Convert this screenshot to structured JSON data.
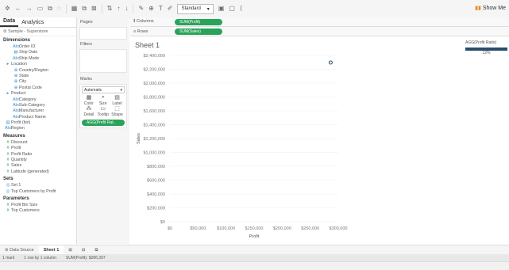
{
  "toolbar": {
    "icons": [
      "tableau-logo-icon",
      "undo-icon",
      "redo-icon",
      "save-icon",
      "new-datasource-icon",
      "pause-icon",
      "swap-icon",
      "sort-asc-icon",
      "sort-desc-icon",
      "highlight-icon",
      "group-icon",
      "label-icon",
      "format-icon",
      "fit-icon",
      "present-icon",
      "share-icon"
    ],
    "fit_select": "Standard",
    "show_me": "Show Me"
  },
  "left_panel": {
    "tabs": [
      "Data",
      "Analytics"
    ],
    "datasource": "Sample - Superstore",
    "dimensions_header": "Dimensions",
    "dimensions": [
      {
        "label": "Order ID",
        "level": 2,
        "icon": "Abc"
      },
      {
        "label": "Ship Date",
        "level": 2,
        "icon": "cal"
      },
      {
        "label": "Ship Mode",
        "level": 2,
        "icon": "Abc"
      },
      {
        "label": "Location",
        "level": 1,
        "icon": "hier"
      },
      {
        "label": "Country/Region",
        "level": 2,
        "icon": "geo"
      },
      {
        "label": "State",
        "level": 2,
        "icon": "geo"
      },
      {
        "label": "City",
        "level": 2,
        "icon": "geo"
      },
      {
        "label": "Postal Code",
        "level": 2,
        "icon": "geo"
      },
      {
        "label": "Product",
        "level": 1,
        "icon": "hier"
      },
      {
        "label": "Category",
        "level": 2,
        "icon": "Abc"
      },
      {
        "label": "Sub-Category",
        "level": 2,
        "icon": "Abc"
      },
      {
        "label": "Manufacturer",
        "level": 2,
        "icon": "Abc"
      },
      {
        "label": "Product Name",
        "level": 2,
        "icon": "Abc"
      },
      {
        "label": "Profit (bin)",
        "level": 1,
        "icon": "bin"
      },
      {
        "label": "Region",
        "level": 1,
        "icon": "Abc"
      }
    ],
    "measures_header": "Measures",
    "measures": [
      {
        "label": "Discount"
      },
      {
        "label": "Profit"
      },
      {
        "label": "Profit Ratio"
      },
      {
        "label": "Quantity"
      },
      {
        "label": "Sales"
      },
      {
        "label": "Latitude (generated)"
      }
    ],
    "sets_header": "Sets",
    "sets": [
      "Set 1",
      "Top Customers by Profit"
    ],
    "parameters_header": "Parameters",
    "parameters": [
      "Profit Bin Size",
      "Top Customers"
    ]
  },
  "pages_label": "Pages",
  "filters_label": "Filters",
  "marks": {
    "label": "Marks",
    "type": "Automatic",
    "buttons": [
      "Color",
      "Size",
      "Label",
      "Detail",
      "Tooltip",
      "Shape"
    ],
    "pill": "AGG(Profit Rat.."
  },
  "shelves": {
    "columns_label": "Columns",
    "columns_pill": "SUM(Profit)",
    "rows_label": "Rows",
    "rows_pill": "SUM(Sales)"
  },
  "sheet_title": "Sheet 1",
  "chart_data": {
    "type": "scatter",
    "title": "Sheet 1",
    "xlabel": "Profit",
    "ylabel": "Sales",
    "x_ticks": [
      "$0",
      "$50,000",
      "$100,000",
      "$150,000",
      "$200,000",
      "$250,000",
      "$300,000"
    ],
    "y_ticks": [
      "$0",
      "$200,000",
      "$400,000",
      "$600,000",
      "$800,000",
      "$1,000,000",
      "$1,200,000",
      "$1,400,000",
      "$1,600,000",
      "$1,800,000",
      "$2,000,000",
      "$2,200,000",
      "$2,400,000"
    ],
    "xlim": [
      0,
      300000
    ],
    "ylim": [
      0,
      2400000
    ],
    "points": [
      {
        "x": 286397,
        "y": 2297201
      }
    ],
    "grid": true
  },
  "legend": {
    "title": "AGG(Profit Ratio)",
    "value": "12%"
  },
  "bottom_tabs": [
    "Data Source",
    "Sheet 1"
  ],
  "status": {
    "marks": "1 mark",
    "dims": "1 row by 1 column",
    "sum": "SUM(Profit): $286,397"
  }
}
